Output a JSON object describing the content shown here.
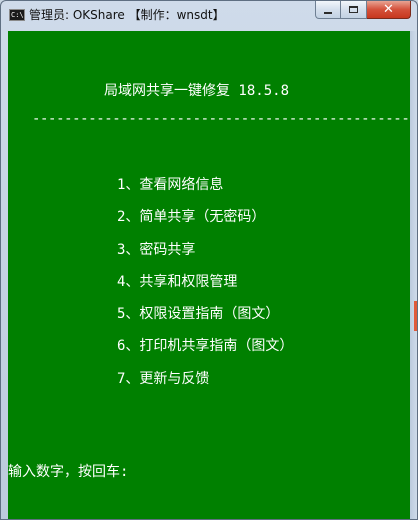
{
  "window": {
    "title": "管理员:  OKShare  【制作：wnsdt】",
    "icon_label": "C:\\",
    "icon": "console-icon",
    "controls": {
      "minimize": "minimize-icon",
      "maximize": "maximize-icon",
      "close": "close-icon",
      "close_glyph": "✕"
    }
  },
  "console": {
    "background_color": "#008000",
    "text_color": "#ffffff",
    "header": "局域网共享一键修复 18.5.8",
    "divider": "------------------------------------------------",
    "menu": [
      "1、查看网络信息",
      "2、简单共享（无密码）",
      "3、密码共享",
      "4、共享和权限管理",
      "5、权限设置指南（图文）",
      "6、打印机共享指南（图文）",
      "7、更新与反馈"
    ],
    "prompt": "输入数字，按回车:"
  }
}
